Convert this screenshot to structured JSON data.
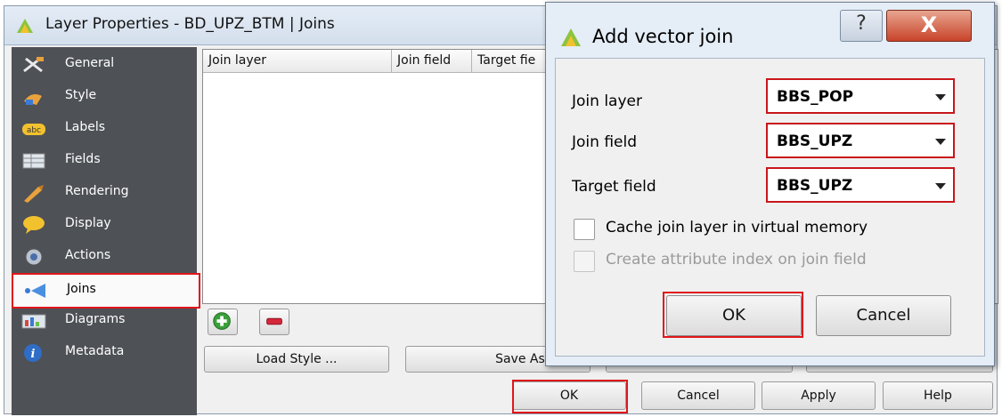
{
  "main_window": {
    "title": "Layer Properties - BD_UPZ_BTM | Joins",
    "sidebar": [
      {
        "label": "General",
        "icon": "general-icon"
      },
      {
        "label": "Style",
        "icon": "style-icon"
      },
      {
        "label": "Labels",
        "icon": "labels-icon"
      },
      {
        "label": "Fields",
        "icon": "fields-icon"
      },
      {
        "label": "Rendering",
        "icon": "rendering-icon"
      },
      {
        "label": "Display",
        "icon": "display-icon"
      },
      {
        "label": "Actions",
        "icon": "actions-icon"
      },
      {
        "label": "Joins",
        "icon": "joins-icon"
      },
      {
        "label": "Diagrams",
        "icon": "diagrams-icon"
      },
      {
        "label": "Metadata",
        "icon": "metadata-icon"
      }
    ],
    "selected_item": "Joins",
    "join_table": {
      "columns": [
        "Join layer",
        "Join field",
        "Target fie"
      ]
    },
    "add_join_icon": "plus-icon",
    "remove_join_icon": "minus-icon",
    "style_buttons": {
      "load_style": "Load Style ...",
      "save_as_default": "Save As Defau"
    },
    "footer_buttons": {
      "ok": "OK",
      "cancel": "Cancel",
      "apply": "Apply",
      "help": "Help"
    }
  },
  "dialog": {
    "title": "Add vector join",
    "help_glyph": "?",
    "close_glyph": "X",
    "fields": [
      {
        "label": "Join layer",
        "value": "BBS_POP"
      },
      {
        "label": "Join field",
        "value": "BBS_UPZ"
      },
      {
        "label": "Target field",
        "value": "BBS_UPZ"
      }
    ],
    "checkboxes": [
      {
        "label": "Cache join layer in virtual memory",
        "checked": false,
        "enabled": true
      },
      {
        "label": "Create attribute index on join field",
        "checked": false,
        "enabled": false
      }
    ],
    "ok": "OK",
    "cancel": "Cancel"
  },
  "colors": {
    "highlight": "#e0161b",
    "sidebar_bg": "#4e5156",
    "dialog_bg": "#e5edf7"
  }
}
